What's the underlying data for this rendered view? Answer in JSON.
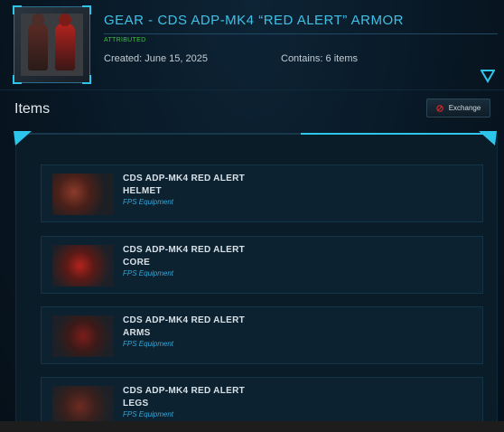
{
  "header": {
    "title": "GEAR - CDS ADP-MK4 “RED ALERT” ARMOR",
    "badge": "ATTRIBUTED",
    "created": "Created: June 15, 2025",
    "contains": "Contains: 6 items",
    "thumbnail_icon": "armor-set-image",
    "expand_icon": "chevron-down-icon"
  },
  "section": {
    "heading": "Items",
    "exchange_label": "Exchange",
    "exchange_icon": "ban-icon"
  },
  "items": [
    {
      "name_line1": "CDS ADP-MK4 RED ALERT",
      "name_line2": "HELMET",
      "category": "FPS Equipment"
    },
    {
      "name_line1": "CDS ADP-MK4 RED ALERT",
      "name_line2": "CORE",
      "category": "FPS Equipment"
    },
    {
      "name_line1": "CDS ADP-MK4 RED ALERT",
      "name_line2": "ARMS",
      "category": "FPS Equipment"
    },
    {
      "name_line1": "CDS ADP-MK4 RED ALERT",
      "name_line2": "LEGS",
      "category": "FPS Equipment"
    }
  ],
  "colors": {
    "accent": "#2ec5ea",
    "title": "#3fc1e6",
    "attributed": "#3ec23e",
    "category": "#34a6d8",
    "background": "#071420"
  }
}
